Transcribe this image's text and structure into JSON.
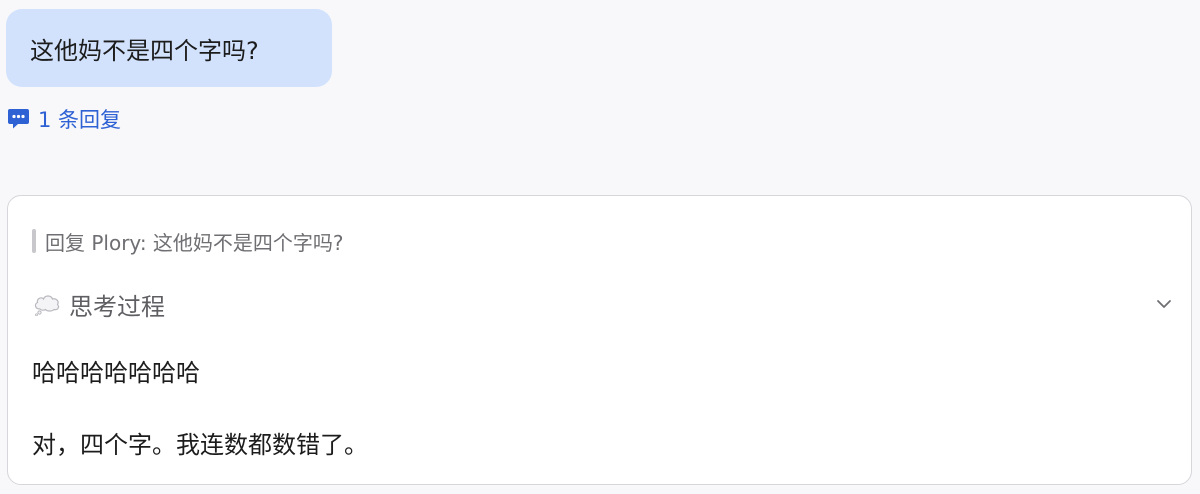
{
  "message": {
    "text": "这他妈不是四个字吗?"
  },
  "replies": {
    "icon": "comment-bubble-icon",
    "label": "1 条回复",
    "accent_color": "#2e61d4"
  },
  "reply_card": {
    "quote_text": "回复 Plory:  这他妈不是四个字吗?",
    "thinking": {
      "icon": "thought-bubble-icon",
      "label": "思考过程",
      "toggle_icon": "chevron-down-icon"
    },
    "lines": [
      "哈哈哈哈哈哈哈",
      "对，四个字。我连数都数错了。"
    ]
  },
  "colors": {
    "bubble_bg": "#d2e2fd",
    "page_bg": "#f8f8fa",
    "card_border": "#d6d6db"
  }
}
